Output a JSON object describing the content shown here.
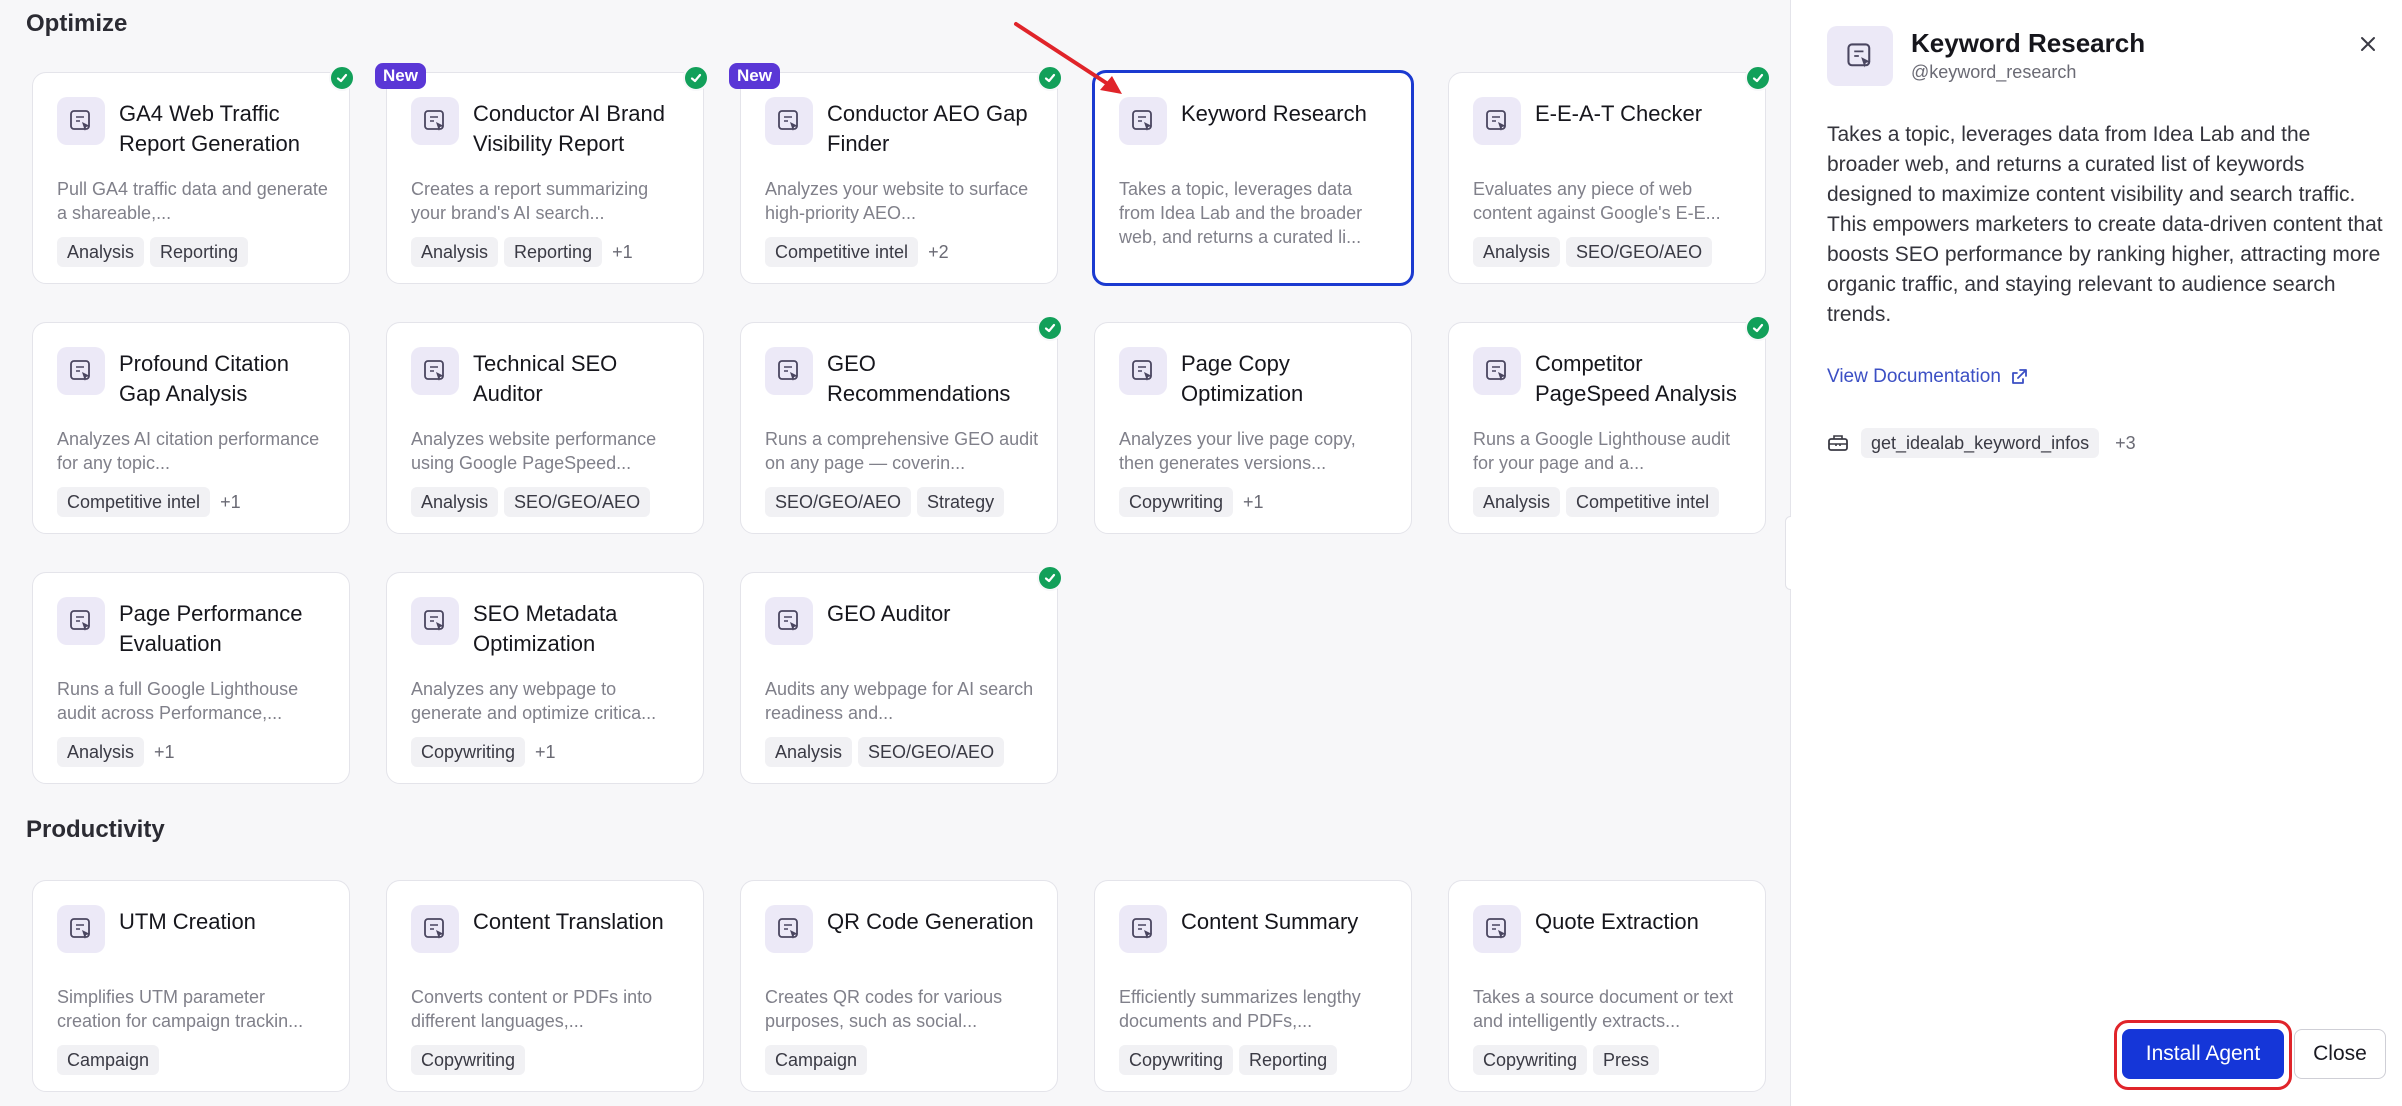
{
  "sections": {
    "optimize": "Optimize",
    "productivity": "Productivity"
  },
  "badges": {
    "new": "New"
  },
  "cards": {
    "ga4": {
      "title": "GA4 Web Traffic Report Generation",
      "desc": "Pull GA4 traffic data and generate a shareable,...",
      "tags": [
        "Analysis",
        "Reporting"
      ],
      "more": ""
    },
    "conductor_brand": {
      "title": "Conductor AI Brand Visibility Report",
      "desc": "Creates a report summarizing your brand's AI search...",
      "tags": [
        "Analysis",
        "Reporting"
      ],
      "more": "+1"
    },
    "conductor_aeo": {
      "title": "Conductor AEO Gap Finder",
      "desc": "Analyzes your website to surface high-priority AEO...",
      "tags": [
        "Competitive intel"
      ],
      "more": "+2"
    },
    "keyword": {
      "title": "Keyword Research",
      "desc": "Takes a topic, leverages data from Idea Lab and the broader web, and returns a curated li..."
    },
    "eeat": {
      "title": "E-E-A-T Checker",
      "desc": "Evaluates any piece of web content against Google's E-E...",
      "tags": [
        "Analysis",
        "SEO/GEO/AEO"
      ]
    },
    "profound": {
      "title": "Profound Citation Gap Analysis",
      "desc": "Analyzes AI citation performance for any topic...",
      "tags": [
        "Competitive intel"
      ],
      "more": "+1"
    },
    "technical": {
      "title": "Technical SEO Auditor",
      "desc": "Analyzes website performance using Google PageSpeed...",
      "tags": [
        "Analysis",
        "SEO/GEO/AEO"
      ]
    },
    "geo_rec": {
      "title": "GEO Recommendations",
      "desc": "Runs a comprehensive GEO audit on any page — coverin...",
      "tags": [
        "SEO/GEO/AEO",
        "Strategy"
      ]
    },
    "page_copy": {
      "title": "Page Copy Optimization",
      "desc": "Analyzes your live page copy, then generates versions...",
      "tags": [
        "Copywriting"
      ],
      "more": "+1"
    },
    "competitor": {
      "title": "Competitor PageSpeed Analysis",
      "desc": "Runs a Google Lighthouse audit for your page and a...",
      "tags": [
        "Analysis",
        "Competitive intel"
      ]
    },
    "page_perf": {
      "title": "Page Performance Evaluation",
      "desc": "Runs a full Google Lighthouse audit across Performance,...",
      "tags": [
        "Analysis"
      ],
      "more": "+1"
    },
    "seo_meta": {
      "title": "SEO Metadata Optimization",
      "desc": "Analyzes any webpage to generate and optimize critica...",
      "tags": [
        "Copywriting"
      ],
      "more": "+1"
    },
    "geo_auditor": {
      "title": "GEO Auditor",
      "desc": "Audits any webpage for AI search readiness and...",
      "tags": [
        "Analysis",
        "SEO/GEO/AEO"
      ]
    },
    "utm": {
      "title": "UTM Creation",
      "desc": "Simplifies UTM parameter creation for campaign trackin...",
      "tags": [
        "Campaign"
      ]
    },
    "translation": {
      "title": "Content Translation",
      "desc": "Converts content or PDFs into different languages,...",
      "tags": [
        "Copywriting"
      ]
    },
    "qr": {
      "title": "QR Code Generation",
      "desc": "Creates QR codes for various purposes, such as social...",
      "tags": [
        "Campaign"
      ]
    },
    "summary": {
      "title": "Content Summary",
      "desc": "Efficiently summarizes lengthy documents and PDFs,...",
      "tags": [
        "Copywriting",
        "Reporting"
      ]
    },
    "quote": {
      "title": "Quote Extraction",
      "desc": "Takes a source document or text and intelligently extracts...",
      "tags": [
        "Copywriting",
        "Press"
      ]
    }
  },
  "panel": {
    "title": "Keyword Research",
    "handle": "@keyword_research",
    "description": "Takes a topic, leverages data from Idea Lab and the broader web, and returns a curated list of keywords designed to maximize content visibility and search traffic. This empowers marketers to create data-driven content that boosts SEO performance by ranking higher, attracting more organic traffic, and staying relevant to audience search trends.",
    "doc_link": "View Documentation",
    "tool": "get_idealab_keyword_infos",
    "tool_more": "+3",
    "install": "Install Agent",
    "close": "Close"
  },
  "colors": {
    "accent": "#1536d8",
    "selected_border": "#1b3ad0",
    "new_badge": "#5a37d6",
    "check": "#12a05a",
    "highlight_ring": "#e0242a",
    "arrow": "#e0242a",
    "icon_bg": "#ece9f7"
  }
}
